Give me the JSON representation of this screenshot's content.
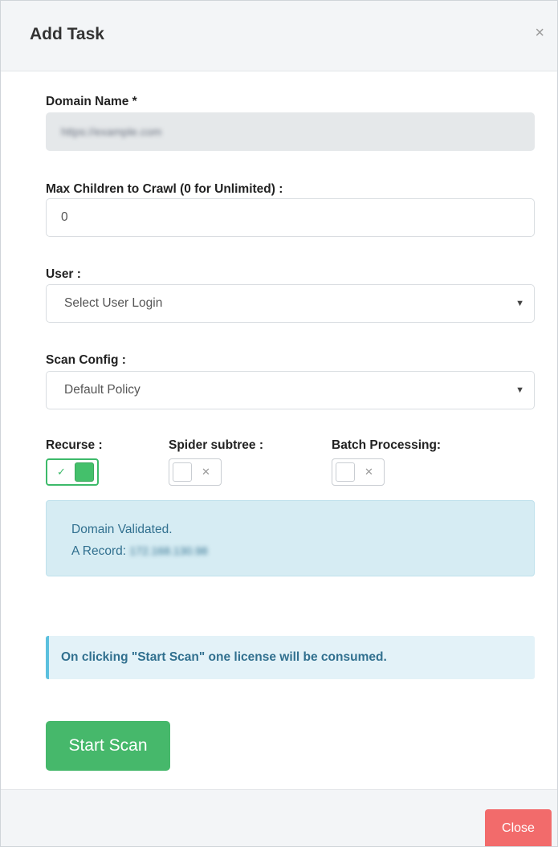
{
  "header": {
    "title": "Add Task",
    "close_glyph": "×"
  },
  "domain": {
    "label": "Domain Name *",
    "value": "https://example.com"
  },
  "max_children": {
    "label": "Max Children to Crawl (0 for Unlimited) :",
    "value": "0"
  },
  "user": {
    "label": "User :",
    "selected": "Select User Login",
    "caret": "▼"
  },
  "scan_config": {
    "label": "Scan Config :",
    "selected": "Default Policy",
    "caret": "▼"
  },
  "toggles": {
    "recurse": {
      "label": "Recurse :",
      "on": true,
      "glyph": "✓"
    },
    "spider_subtree": {
      "label": "Spider subtree :",
      "on": false,
      "glyph": "✕"
    },
    "batch_processing": {
      "label": "Batch Processing:",
      "on": false,
      "glyph": "✕"
    }
  },
  "validation": {
    "line1": "Domain Validated.",
    "a_record_label": "A Record:",
    "a_record_value": "172.168.130.98"
  },
  "notice": "On clicking \"Start Scan\" one license will be consumed.",
  "actions": {
    "start_scan": "Start Scan"
  },
  "footer": {
    "close_label": "Close"
  },
  "colors": {
    "primary_success": "#46b86b",
    "danger": "#f26b6b",
    "info_bg": "#d6ecf3",
    "info_text": "#31708f",
    "callout_border": "#5bc0de"
  },
  "icons": {
    "close": "close-icon",
    "check": "check-icon",
    "cross": "x-icon",
    "caret": "chevron-down-icon"
  }
}
